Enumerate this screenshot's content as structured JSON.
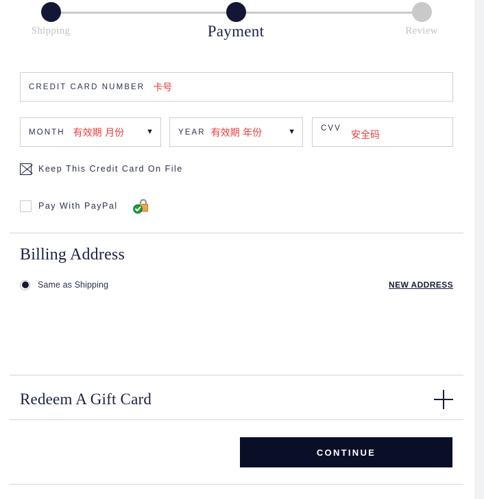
{
  "stepper": {
    "steps": [
      {
        "label": "Shipping",
        "state": "done"
      },
      {
        "label": "Payment",
        "state": "current"
      },
      {
        "label": "Review",
        "state": "todo"
      }
    ]
  },
  "payment_form": {
    "card_number": {
      "label": "CREDIT CARD NUMBER",
      "value": "卡号"
    },
    "month": {
      "label": "MONTH",
      "value": "有效期 月份",
      "chevron": "▼"
    },
    "year": {
      "label": "YEAR",
      "value": "有效期 年份",
      "chevron": "▼"
    },
    "cvv": {
      "label": "CVV",
      "value": "安全码"
    },
    "keep_on_file": {
      "label": "Keep This Credit Card On File",
      "checked": true
    },
    "pay_with_paypal": {
      "label": "Pay With PayPal",
      "checked": false,
      "icon": "secure-lock-icon"
    }
  },
  "billing": {
    "title": "Billing Address",
    "same_as_shipping_label": "Same as Shipping",
    "same_as_shipping_selected": true,
    "new_address_link": "NEW ADDRESS"
  },
  "gift_card": {
    "title": "Redeem A Gift Card",
    "expand_icon": "plus-icon"
  },
  "footer": {
    "continue_label": "CONTINUE"
  },
  "colors": {
    "navy": "#131634",
    "button_bg": "#0a0f28",
    "step_inactive": "#c9c9c9",
    "field_border": "#cfcfd2",
    "value_red": "#ef3b3b",
    "divider": "#d6d6d8"
  }
}
